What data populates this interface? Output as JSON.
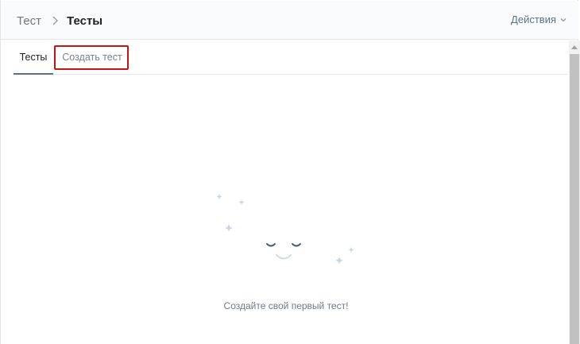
{
  "header": {
    "breadcrumb_root": "Тест",
    "breadcrumb_current": "Тесты",
    "actions_label": "Действия"
  },
  "tabs": [
    {
      "label": "Тесты",
      "active": true
    },
    {
      "label": "Создать тест",
      "active": false
    }
  ],
  "empty_state": {
    "message": "Создайте свой первый тест!"
  },
  "icons": {
    "breadcrumb_separator": "chevron-right-icon",
    "actions_dropdown": "chevron-down-icon",
    "illustration": "smiling-face-icon"
  },
  "colors": {
    "accent": "#5c6f87",
    "highlight": "#cc1111",
    "illustration": "#c7d6e5"
  }
}
